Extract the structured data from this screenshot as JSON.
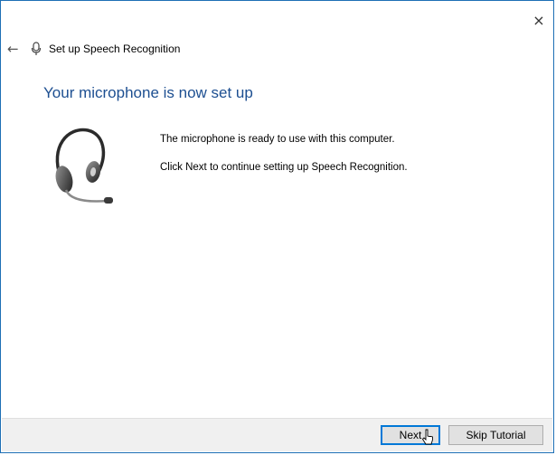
{
  "window": {
    "close_glyph": "×"
  },
  "header": {
    "back_glyph": "←",
    "title": "Set up Speech Recognition"
  },
  "main": {
    "heading": "Your microphone is now set up",
    "message_ready": "The microphone is ready to use with this computer.",
    "message_next": "Click Next to continue setting up Speech Recognition."
  },
  "footer": {
    "next_label": "Next",
    "skip_label": "Skip Tutorial"
  },
  "colors": {
    "heading": "#1d4f91",
    "footer_bg": "#f0f0f0",
    "accent": "#0078d7"
  }
}
